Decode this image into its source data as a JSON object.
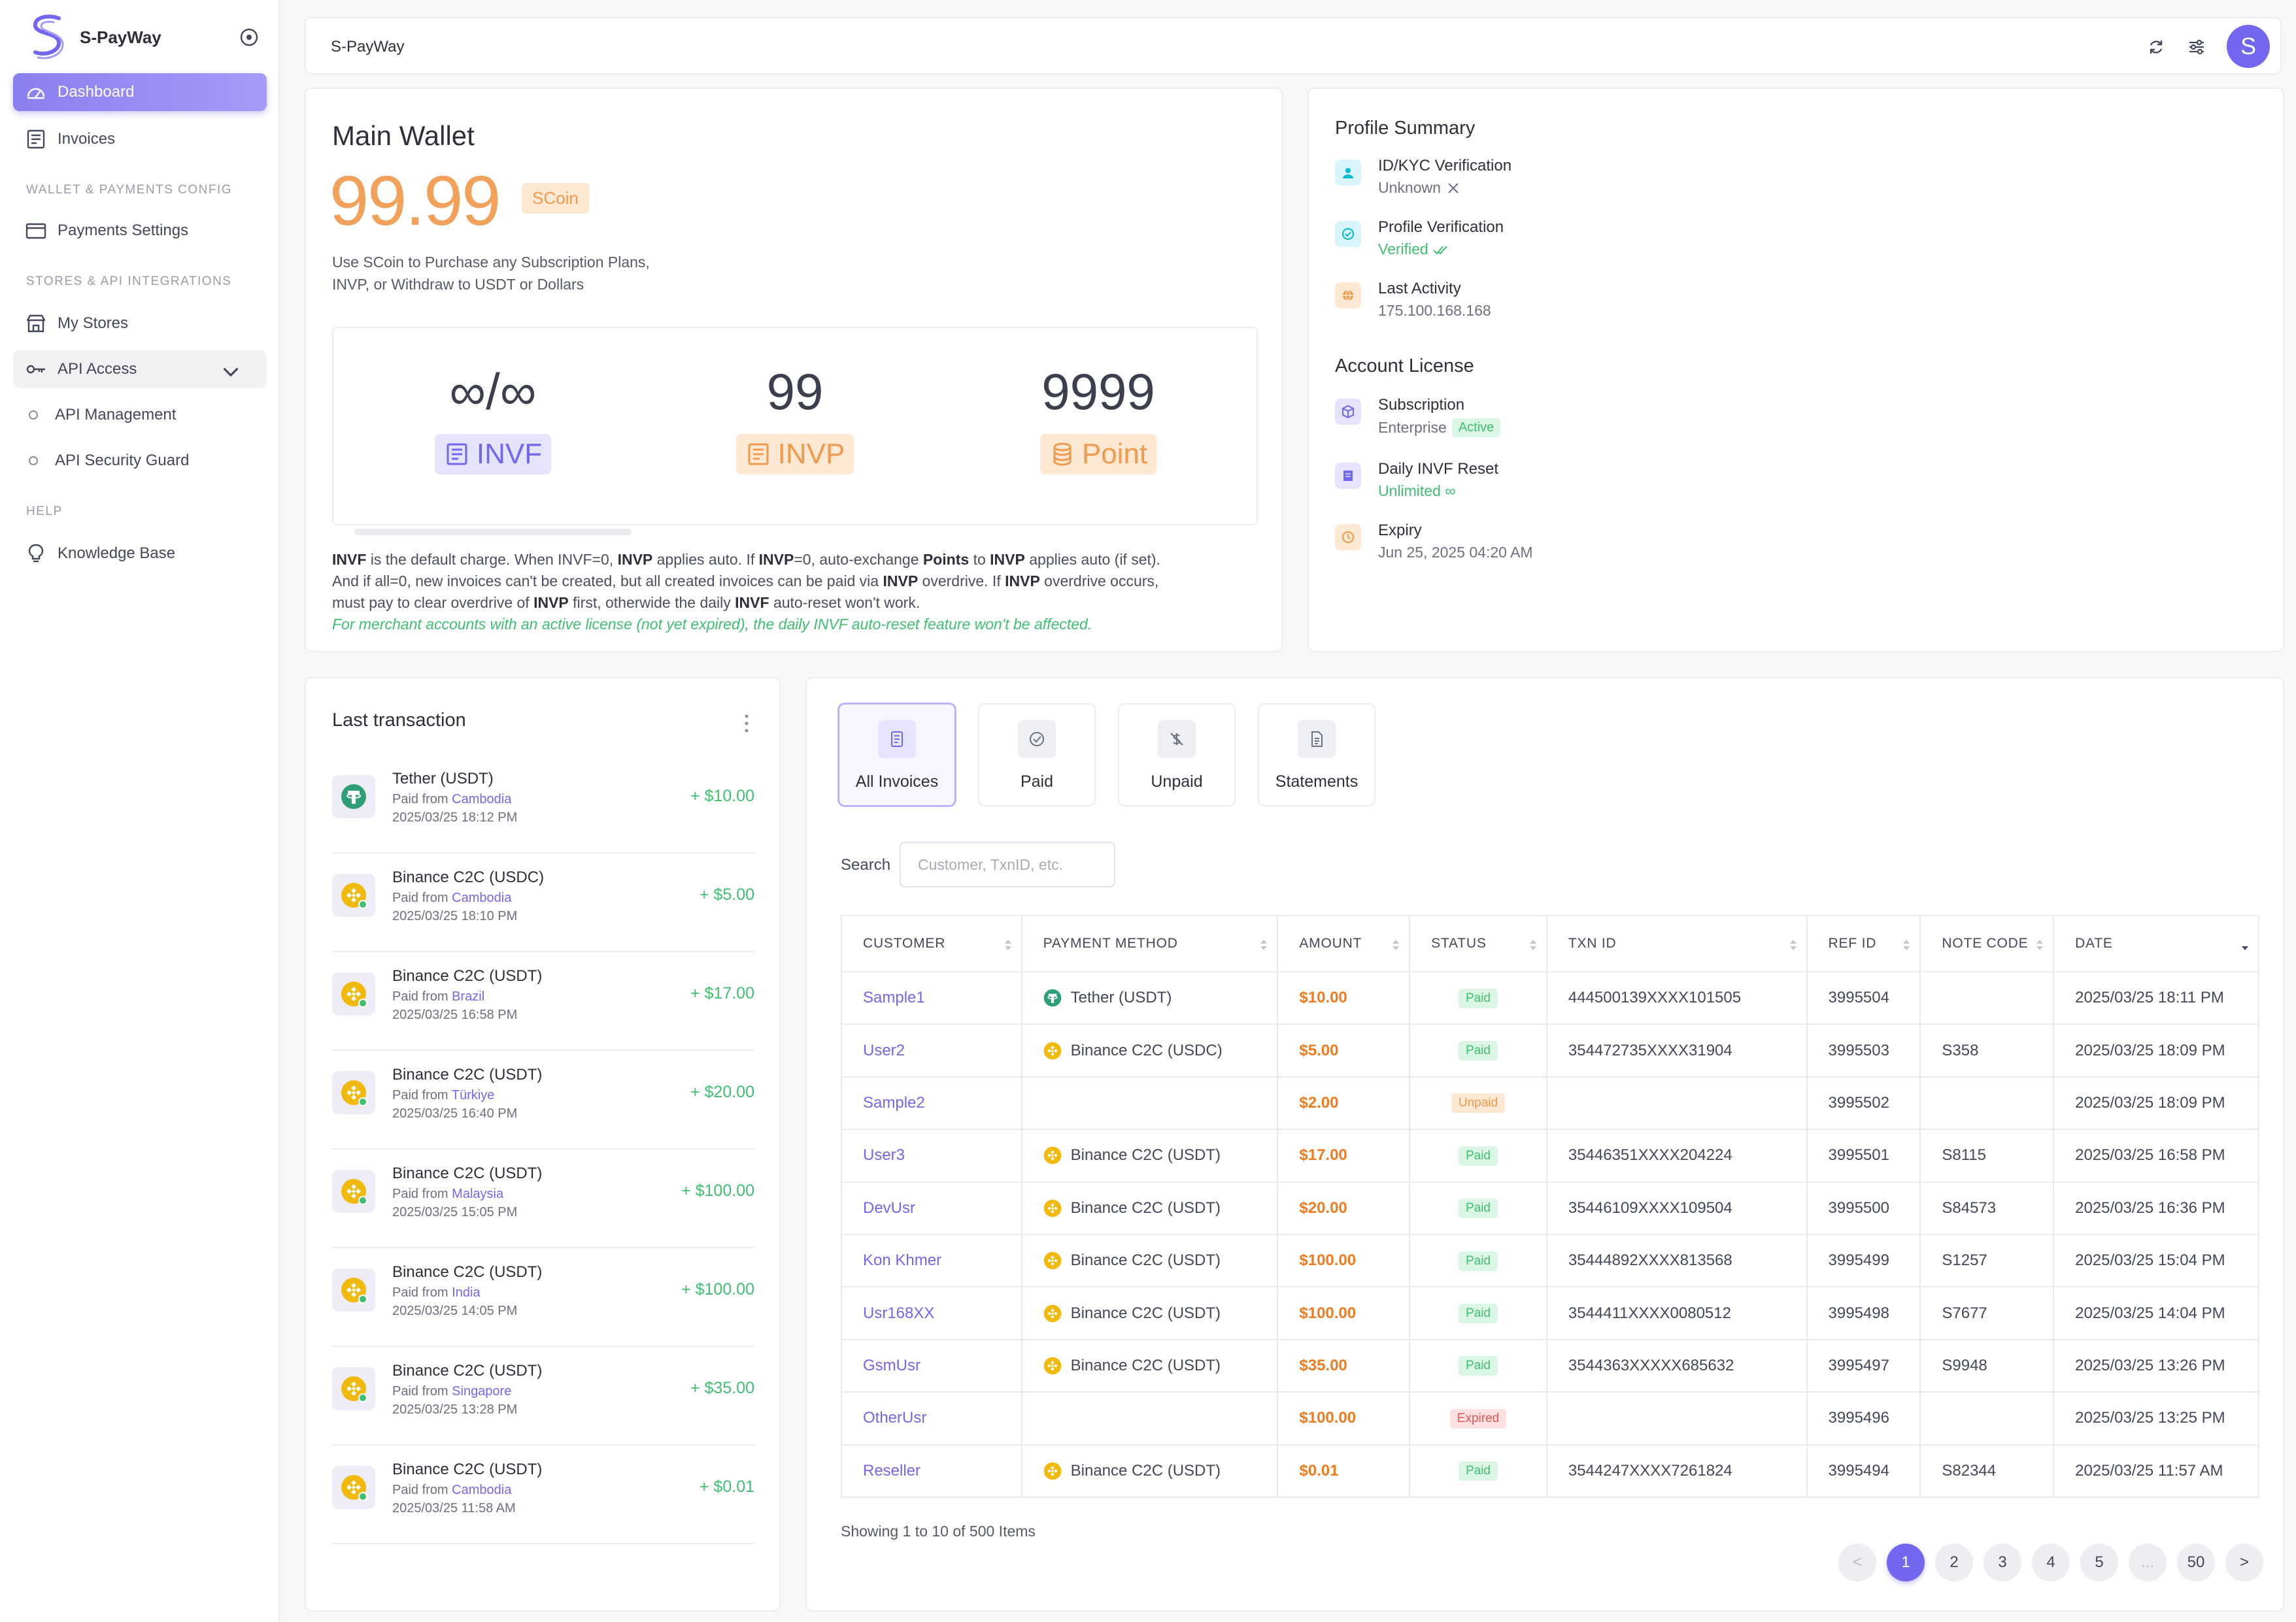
{
  "app": {
    "name": "S-PayWay",
    "topbar_title": "S-PayWay",
    "avatar_letter": "S",
    "accent": "#7367f0"
  },
  "sidebar": {
    "dashboard": "Dashboard",
    "invoices": "Invoices",
    "section_wallet": "WALLET & PAYMENTS CONFIG",
    "payments_settings": "Payments Settings",
    "section_stores": "STORES & API INTEGRATIONS",
    "my_stores": "My Stores",
    "api_access": "API Access",
    "api_management": "API Management",
    "api_security_guard": "API Security Guard",
    "section_help": "HELP",
    "knowledge_base": "Knowledge Base"
  },
  "wallet": {
    "title": "Main Wallet",
    "balance": "99.99",
    "unit": "SCoin",
    "desc_line1": "Use SCoin to Purchase any Subscription Plans,",
    "desc_line2": "INVP, or Withdraw to USDT or Dollars",
    "counters": [
      {
        "value": "∞/∞",
        "label": "INVF"
      },
      {
        "value": "99",
        "label": "INVP"
      },
      {
        "value": "9999",
        "label": "Point"
      }
    ],
    "invf_progress": 0,
    "note": {
      "l1a": "INVF",
      "l1b": " is the default charge. When INVF=0, ",
      "l1c": "INVP",
      "l1d": " applies auto. If ",
      "l1e": "INVP",
      "l1f": "=0, auto-exchange ",
      "l1g": "Points",
      "l1h": " to ",
      "l1i": "INVP",
      "l1j": " applies auto (if set).",
      "l2a": "And if all=0, new invoices can't be created, but all created invoices can be paid via ",
      "l2b": "INVP",
      "l2c": " overdrive. If ",
      "l2d": "INVP",
      "l2e": " overdrive occurs,",
      "l3a": "must pay to clear overdrive of ",
      "l3b": "INVP",
      "l3c": " first, otherwide the daily ",
      "l3d": "INVF",
      "l3e": " auto-reset won't work.",
      "l4": "For merchant accounts with an active license (not yet expired), the daily INVF auto-reset feature won't be affected."
    }
  },
  "profile": {
    "title": "Profile Summary",
    "kyc_label": "ID/KYC Verification",
    "kyc_value": "Unknown",
    "pv_label": "Profile Verification",
    "pv_value": "Verified",
    "la_label": "Last Activity",
    "la_value": "175.100.168.168",
    "license_title": "Account License",
    "sub_label": "Subscription",
    "sub_value": "Enterprise",
    "sub_badge": "Active",
    "reset_label": "Daily INVF Reset",
    "reset_value": "Unlimited ∞",
    "exp_label": "Expiry",
    "exp_value": "Jun 25, 2025 04:20 AM"
  },
  "last_tx": {
    "title": "Last transaction",
    "paid_from": "Paid from ",
    "items": [
      {
        "name": "Tether (USDT)",
        "country": "Cambodia",
        "date": "2025/03/25 18:12 PM",
        "amount": "+ $10.00",
        "coin": "tether"
      },
      {
        "name": "Binance C2C (USDC)",
        "country": "Cambodia",
        "date": "2025/03/25 18:10 PM",
        "amount": "+ $5.00",
        "coin": "binance"
      },
      {
        "name": "Binance C2C (USDT)",
        "country": "Brazil",
        "date": "2025/03/25 16:58 PM",
        "amount": "+ $17.00",
        "coin": "binance"
      },
      {
        "name": "Binance C2C (USDT)",
        "country": "Türkiye",
        "date": "2025/03/25 16:40 PM",
        "amount": "+ $20.00",
        "coin": "binance"
      },
      {
        "name": "Binance C2C (USDT)",
        "country": "Malaysia",
        "date": "2025/03/25 15:05 PM",
        "amount": "+ $100.00",
        "coin": "binance"
      },
      {
        "name": "Binance C2C (USDT)",
        "country": "India",
        "date": "2025/03/25 14:05 PM",
        "amount": "+ $100.00",
        "coin": "binance"
      },
      {
        "name": "Binance C2C (USDT)",
        "country": "Singapore",
        "date": "2025/03/25 13:28 PM",
        "amount": "+ $35.00",
        "coin": "binance"
      },
      {
        "name": "Binance C2C (USDT)",
        "country": "Cambodia",
        "date": "2025/03/25 11:58 AM",
        "amount": "+ $0.01",
        "coin": "binance"
      }
    ]
  },
  "invoices": {
    "tabs": [
      "All Invoices",
      "Paid",
      "Unpaid",
      "Statements"
    ],
    "search_label": "Search",
    "search_placeholder": "Customer, TxnID, etc.",
    "columns": [
      "CUSTOMER",
      "PAYMENT METHOD",
      "AMOUNT",
      "STATUS",
      "TXN ID",
      "REF ID",
      "NOTE CODE",
      "DATE"
    ],
    "rows": [
      {
        "customer": "Sample1",
        "method": "Tether (USDT)",
        "coin": "tether",
        "amount": "$10.00",
        "status": "Paid",
        "txn": "444500139XXXX101505",
        "ref": "3995504",
        "note": "",
        "date": "2025/03/25 18:11 PM"
      },
      {
        "customer": "User2",
        "method": "Binance C2C (USDC)",
        "coin": "binance",
        "amount": "$5.00",
        "status": "Paid",
        "txn": "354472735XXXX31904",
        "ref": "3995503",
        "note": "S358",
        "date": "2025/03/25 18:09 PM"
      },
      {
        "customer": "Sample2",
        "method": "",
        "coin": "",
        "amount": "$2.00",
        "status": "Unpaid",
        "txn": "",
        "ref": "3995502",
        "note": "",
        "date": "2025/03/25 18:09 PM"
      },
      {
        "customer": "User3",
        "method": "Binance C2C (USDT)",
        "coin": "binance",
        "amount": "$17.00",
        "status": "Paid",
        "txn": "35446351XXXX204224",
        "ref": "3995501",
        "note": "S8115",
        "date": "2025/03/25 16:58 PM"
      },
      {
        "customer": "DevUsr",
        "method": "Binance C2C (USDT)",
        "coin": "binance",
        "amount": "$20.00",
        "status": "Paid",
        "txn": "35446109XXXX109504",
        "ref": "3995500",
        "note": "S84573",
        "date": "2025/03/25 16:36 PM"
      },
      {
        "customer": "Kon Khmer",
        "method": "Binance C2C (USDT)",
        "coin": "binance",
        "amount": "$100.00",
        "status": "Paid",
        "txn": "35444892XXXX813568",
        "ref": "3995499",
        "note": "S1257",
        "date": "2025/03/25 15:04 PM"
      },
      {
        "customer": "Usr168XX",
        "method": "Binance C2C (USDT)",
        "coin": "binance",
        "amount": "$100.00",
        "status": "Paid",
        "txn": "3544411XXXX0080512",
        "ref": "3995498",
        "note": "S7677",
        "date": "2025/03/25 14:04 PM"
      },
      {
        "customer": "GsmUsr",
        "method": "Binance C2C (USDT)",
        "coin": "binance",
        "amount": "$35.00",
        "status": "Paid",
        "txn": "3544363XXXXX685632",
        "ref": "3995497",
        "note": "S9948",
        "date": "2025/03/25 13:26 PM"
      },
      {
        "customer": "OtherUsr",
        "method": "",
        "coin": "",
        "amount": "$100.00",
        "status": "Expired",
        "txn": "",
        "ref": "3995496",
        "note": "",
        "date": "2025/03/25 13:25 PM"
      },
      {
        "customer": "Reseller",
        "method": "Binance C2C (USDT)",
        "coin": "binance",
        "amount": "$0.01",
        "status": "Paid",
        "txn": "3544247XXXX7261824",
        "ref": "3995494",
        "note": "S82344",
        "date": "2025/03/25 11:57 AM"
      }
    ],
    "showing": "Showing 1 to 10 of 500 Items",
    "pages": [
      "<",
      "1",
      "2",
      "3",
      "4",
      "5",
      "...",
      "50",
      ">"
    ],
    "current_page": "1"
  }
}
